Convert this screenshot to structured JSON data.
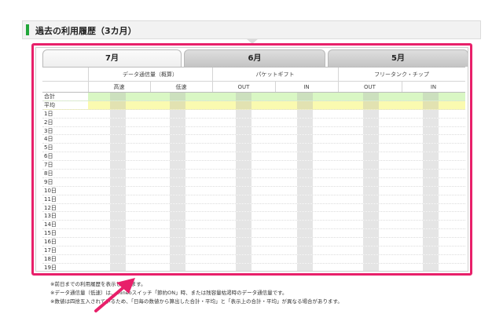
{
  "section": {
    "title": "過去の利用履歴（3カ月）"
  },
  "tabs": [
    {
      "label": "7月",
      "active": true
    },
    {
      "label": "6月",
      "active": false
    },
    {
      "label": "5月",
      "active": false
    }
  ],
  "table": {
    "group_headers": [
      "データ通信量（概算）",
      "パケットギフト",
      "フリータンク・チップ"
    ],
    "sub_headers": [
      "高速",
      "低速",
      "OUT",
      "IN",
      "OUT",
      "IN"
    ],
    "row_labels": [
      "合計",
      "平均",
      "1日",
      "2日",
      "3日",
      "4日",
      "5日",
      "6日",
      "7日",
      "8日",
      "9日",
      "10日",
      "11日",
      "12日",
      "13日",
      "14日",
      "15日",
      "16日",
      "17日",
      "18日",
      "19日"
    ]
  },
  "notes": [
    "※前日までの利用履歴を表示しています。",
    "※データ通信量（低速）は、mineoスイッチ「節約ON」時、または残容量枯渇時のデータ通信量です。",
    "※数値は四捨五入されているため、「日毎の数値から算出した合計・平均」と「表示上の合計・平均」が異なる場合があります。"
  ],
  "colors": {
    "accent_green": "#22a63a",
    "highlight_pink": "#e8206a",
    "total_row": "#d9f7c4",
    "average_row": "#fafab0"
  }
}
